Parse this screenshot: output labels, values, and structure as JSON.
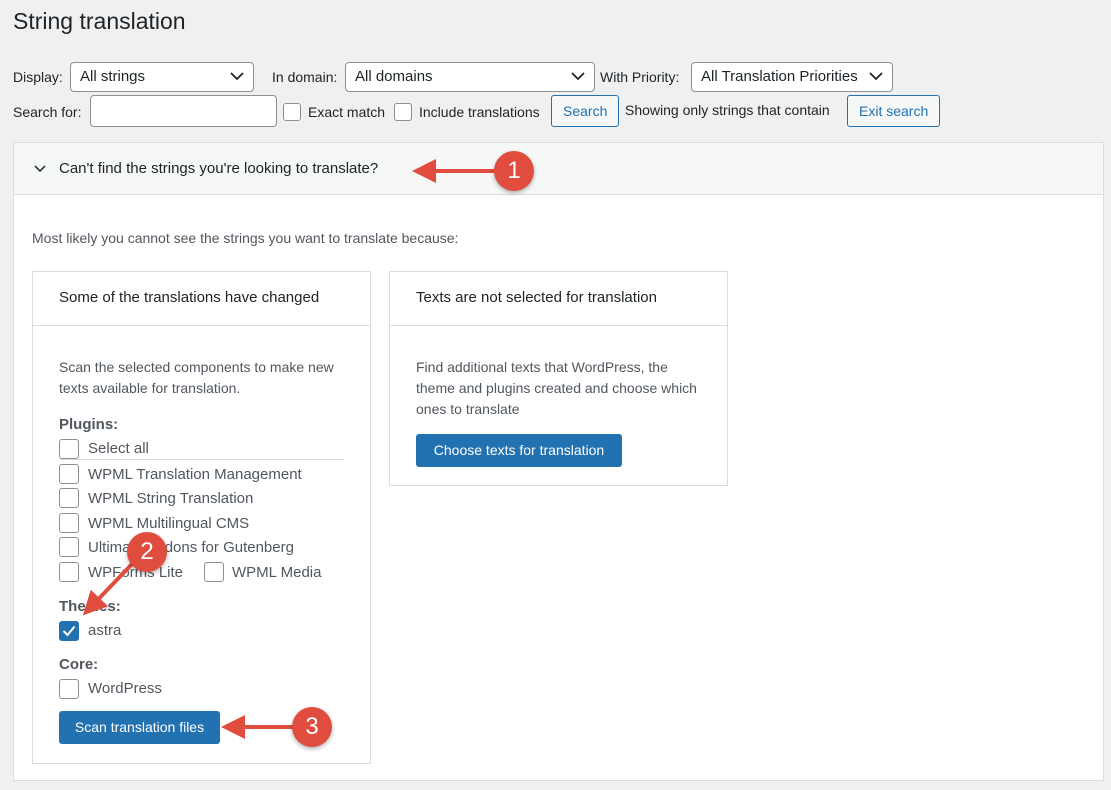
{
  "page": {
    "title": "String translation"
  },
  "filters": {
    "display_label": "Display:",
    "display_value": "All strings",
    "domain_label": "In domain:",
    "domain_value": "All domains",
    "priority_label": "With Priority:",
    "priority_value": "All Translation Priorities",
    "search_label": "Search for:",
    "search_value": "",
    "exact_match_label": "Exact match",
    "include_translations_label": "Include translations",
    "search_button": "Search",
    "showing_text": "Showing only strings that contain",
    "exit_search_button": "Exit search"
  },
  "help_panel": {
    "toggle_label": "Can't find the strings you're looking to translate?",
    "intro": "Most likely you cannot see the strings you want to translate because:",
    "card_changed": {
      "title": "Some of the translations have changed",
      "description": "Scan the selected components to make new texts available for translation.",
      "plugins_label": "Plugins:",
      "plugins": [
        {
          "label": "Select all",
          "checked": false
        },
        {
          "label": "WPML Translation Management",
          "checked": false
        },
        {
          "label": "WPML String Translation",
          "checked": false
        },
        {
          "label": "WPML Multilingual CMS",
          "checked": false
        },
        {
          "label": "Ultimate Addons for Gutenberg",
          "checked": false
        },
        {
          "label": "WPForms Lite",
          "checked": false
        },
        {
          "label": "WPML Media",
          "checked": false
        }
      ],
      "themes_label": "Themes:",
      "themes": [
        {
          "label": "astra",
          "checked": true
        }
      ],
      "core_label": "Core:",
      "core": [
        {
          "label": "WordPress",
          "checked": false
        }
      ],
      "scan_button": "Scan translation files"
    },
    "card_not_selected": {
      "title": "Texts are not selected for translation",
      "description": "Find additional texts that WordPress, the theme and plugins created and choose which ones to translate",
      "choose_button": "Choose texts for translation"
    }
  },
  "annotations": {
    "callout_1": "1",
    "callout_2": "2",
    "callout_3": "3"
  },
  "colors": {
    "accent": "#2271b1",
    "callout": "#e04d3f",
    "page_bg": "#f0f0f1"
  }
}
